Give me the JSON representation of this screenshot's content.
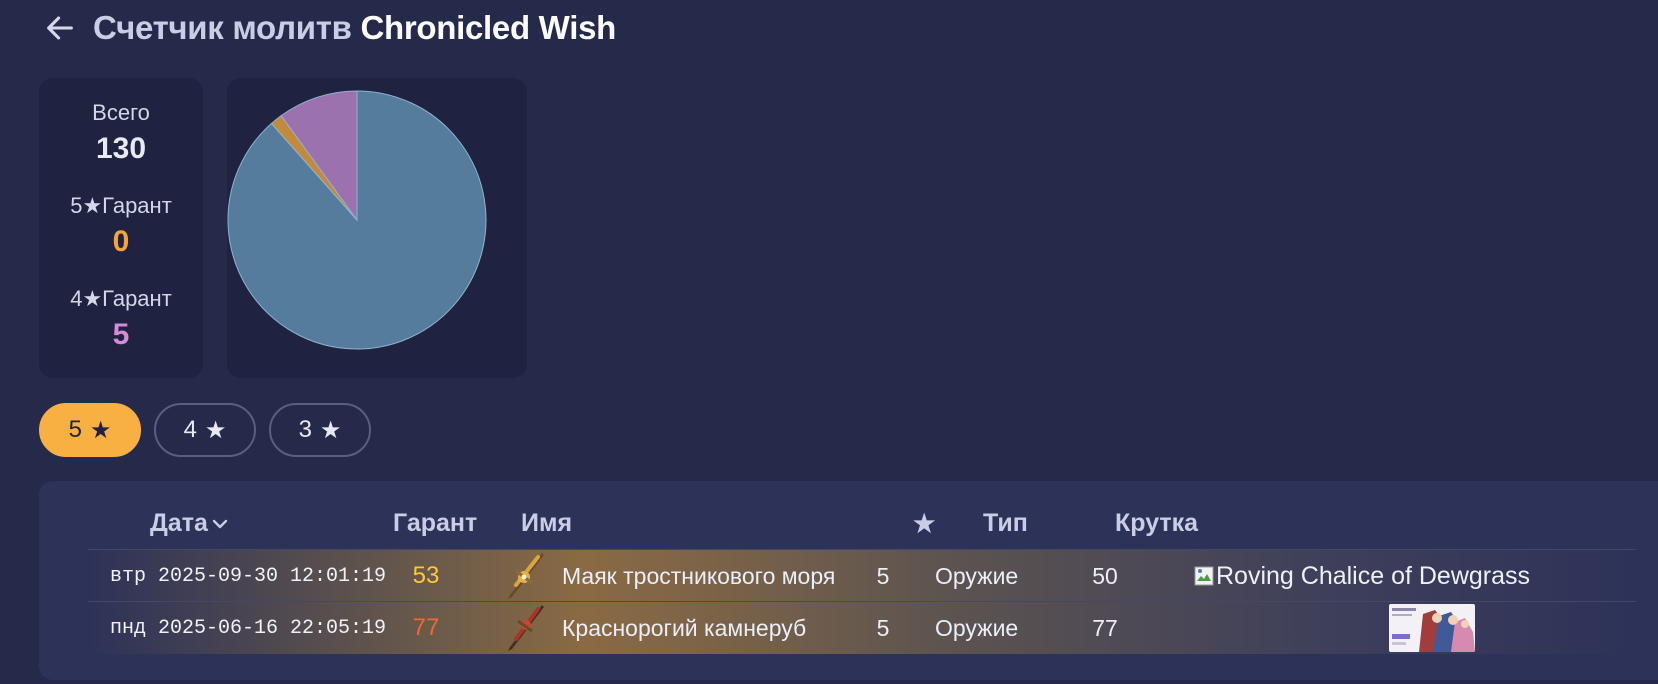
{
  "header": {
    "title_part1": "Счетчик молитв",
    "title_part2": "Chronicled Wish",
    "back_icon": "arrow-left-icon"
  },
  "stats": {
    "total_label": "Всего",
    "total_value": "130",
    "five_star_label": "5★Гарант",
    "five_star_value": "0",
    "four_star_label": "4★Гарант",
    "four_star_value": "5",
    "colors": {
      "five_star": "#f8a23a",
      "four_star": "#d48bd8"
    }
  },
  "chart_data": {
    "type": "pie",
    "values": [
      115,
      2,
      13
    ],
    "colors": [
      "#557c9c",
      "#c48a3b",
      "#9b72ad"
    ]
  },
  "filters": [
    {
      "label": "5",
      "icon": "star-icon",
      "active": true
    },
    {
      "label": "4",
      "icon": "star-icon",
      "active": false
    },
    {
      "label": "3",
      "icon": "star-icon",
      "active": false
    }
  ],
  "table": {
    "headers": {
      "date": "Дата",
      "pity": "Гарант",
      "name": "Имя",
      "star": "★",
      "type": "Тип",
      "roll": "Крутка"
    },
    "rows": [
      {
        "date": "втр 2025-09-30 12:01:19",
        "pity": "53",
        "pity_color": "#ffc83a",
        "name": "Маяк тростникового моря",
        "stars": "5",
        "type": "Оружие",
        "roll": "50",
        "banner_alt": "Roving Chalice of Dewgrass"
      },
      {
        "date": "пнд 2025-06-16 22:05:19",
        "pity": "77",
        "pity_color": "#f0663a",
        "name": "Краснорогий камнеруб",
        "stars": "5",
        "type": "Оружие",
        "roll": "77",
        "banner_alt": ""
      }
    ]
  }
}
